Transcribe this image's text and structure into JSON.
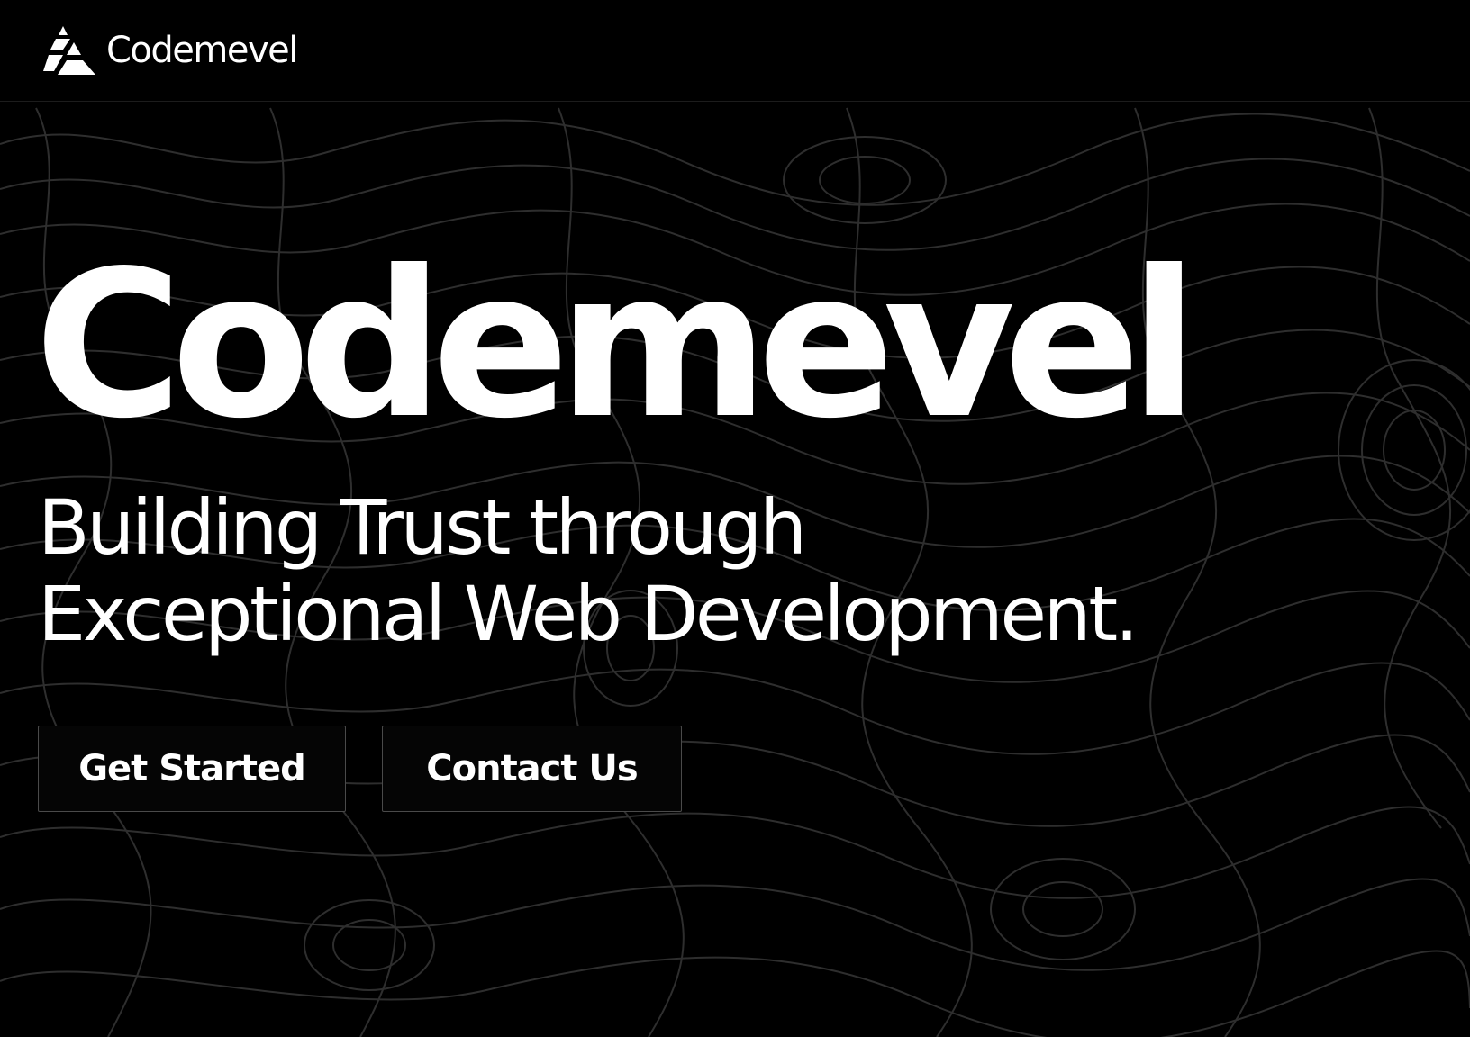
{
  "navbar": {
    "brand_name": "Codemevel",
    "logo_icon": "stacked-triangle-logo-icon"
  },
  "hero": {
    "title": "Codemevel",
    "subtitle_line1": "Building Trust through",
    "subtitle_line2": "Exceptional Web Development."
  },
  "actions": {
    "get_started_label": "Get Started",
    "contact_label": "Contact Us"
  },
  "theme": {
    "background": "#000000",
    "text": "#ffffff",
    "contour_lines": "#2e2e2e",
    "button_border": "#4a4a4a"
  },
  "background_pattern": "topographic-contour-lines"
}
